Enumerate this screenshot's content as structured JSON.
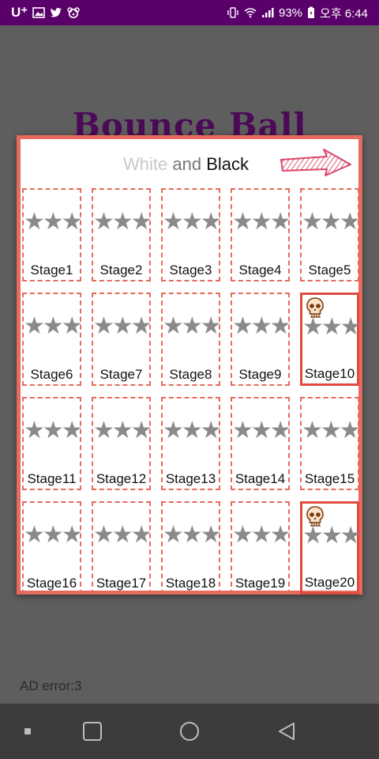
{
  "status_bar": {
    "carrier": "U⁺",
    "battery": "93%",
    "time": "오후 6:44",
    "background": "#5a006a"
  },
  "background": {
    "game_title": "Bounce Ball",
    "ad_error": "AD error:3"
  },
  "dialog": {
    "title_white": "White",
    "title_and": "and",
    "title_black": "Black",
    "accent_color": "#e66a5d",
    "next_icon": "next-arrow-icon",
    "stages": [
      {
        "label": "Stage1",
        "stars": "★★★",
        "unlocked": false
      },
      {
        "label": "Stage2",
        "stars": "★★★",
        "unlocked": false
      },
      {
        "label": "Stage3",
        "stars": "★★★",
        "unlocked": false
      },
      {
        "label": "Stage4",
        "stars": "★★★",
        "unlocked": false
      },
      {
        "label": "Stage5",
        "stars": "★★★",
        "unlocked": false
      },
      {
        "label": "Stage6",
        "stars": "★★★",
        "unlocked": false
      },
      {
        "label": "Stage7",
        "stars": "★★★",
        "unlocked": false
      },
      {
        "label": "Stage8",
        "stars": "★★★",
        "unlocked": false
      },
      {
        "label": "Stage9",
        "stars": "★★★",
        "unlocked": false
      },
      {
        "label": "Stage10",
        "stars": "★★★",
        "unlocked": true,
        "icon": "skull-icon"
      },
      {
        "label": "Stage11",
        "stars": "★★★",
        "unlocked": false
      },
      {
        "label": "Stage12",
        "stars": "★★★",
        "unlocked": false
      },
      {
        "label": "Stage13",
        "stars": "★★★",
        "unlocked": false
      },
      {
        "label": "Stage14",
        "stars": "★★★",
        "unlocked": false
      },
      {
        "label": "Stage15",
        "stars": "★★★",
        "unlocked": false
      },
      {
        "label": "Stage16",
        "stars": "★★★",
        "unlocked": false
      },
      {
        "label": "Stage17",
        "stars": "★★★",
        "unlocked": false
      },
      {
        "label": "Stage18",
        "stars": "★★★",
        "unlocked": false
      },
      {
        "label": "Stage19",
        "stars": "★★★",
        "unlocked": false
      },
      {
        "label": "Stage20",
        "stars": "★★★",
        "unlocked": true,
        "icon": "skull-icon"
      }
    ]
  },
  "nav_bar": {
    "buttons": [
      "recent-apps-dot-icon",
      "overview-square-icon",
      "home-circle-icon",
      "back-triangle-icon"
    ]
  }
}
